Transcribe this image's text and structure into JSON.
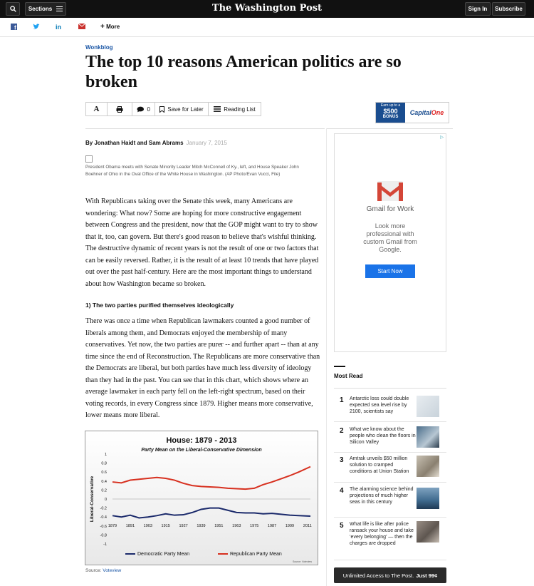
{
  "nav": {
    "sections_label": "Sections",
    "logo": "The Washington Post",
    "signin_label": "Sign In",
    "subscribe_label": "Subscribe"
  },
  "share": {
    "more_label": "More"
  },
  "article": {
    "kicker": "Wonkblog",
    "headline": "The top 10 reasons American politics are so broken",
    "comment_count": "0",
    "save_label": "Save for Later",
    "reading_list_label": "Reading List",
    "byline": "By Jonathan Haidt and Sam Abrams",
    "date": "January 7, 2015",
    "caption": "President Obama meets with Senate Minority Leader Mitch McConnell of Ky., left, and House Speaker John Boehner of Ohio in the Oval Office of the White House in Washington. (AP Photo/Evan Vucci, File)",
    "para1": "With Republicans taking over the Senate this week, many Americans are wondering: What now? Some are hoping for more constructive engagement between Congress and the president, now that the GOP might want to try to show that it, too, can govern. But there's good reason to believe that's wishful thinking. The destructive dynamic of recent years is not the result of one or two factors that can be easily reversed. Rather, it is the result of at least 10 trends that have played out over the past half-century. Here are the most important things to understand about how Washington became so broken.",
    "subhead1": "1) The two parties purified themselves ideologically",
    "para2": "There was once a time when Republican lawmakers counted a good number of liberals among them, and Democrats enjoyed the membership of many conservatives. Yet now, the two parties are purer -- and further apart --  than at any time since the end of Reconstruction. The Republicans are more conservative than the Democrats are liberal, but both parties have much less diversity of ideology than they had in the past. You can see that in this chart, which shows where an average lawmaker in each party fell on the left-right spectrum, based on their voting records, in every Congress since 1879. Higher means more conservative, lower means more liberal.",
    "source_prefix": "Source: ",
    "source_link": "Voteview"
  },
  "banner_ad": {
    "line1": "Earn up to a",
    "amount": "$500",
    "bonus": "BONUS",
    "brand_a": "Capital",
    "brand_b": "One"
  },
  "side_ad": {
    "title": "Gmail for Work",
    "body": "Look more professional with custom Gmail from Google.",
    "button": "Start Now"
  },
  "most_read": {
    "title": "Most Read",
    "items": [
      {
        "num": "1",
        "text": "Antarctic loss could double expected sea level rise by 2100, scientists say"
      },
      {
        "num": "2",
        "text": "What we know about the people who clean the floors in Silicon Valley"
      },
      {
        "num": "3",
        "text": "Amtrak unveils $50 million solution to cramped conditions at Union Station"
      },
      {
        "num": "4",
        "text": "The alarming science behind projections of much higher seas in this century"
      },
      {
        "num": "5",
        "text": "What life is like after police ransack your house and take ‘every belonging’ — then the charges are dropped"
      }
    ]
  },
  "cta": {
    "text": "Unlimited Access to The Post.",
    "price": "Just 99¢"
  },
  "colors": {
    "democratic": "#1b2a6b",
    "republican": "#d7301f",
    "link": "#1955a5"
  },
  "chart_data": {
    "type": "line",
    "title": "House: 1879 - 2013",
    "subtitle": "Party Mean on the Liberal-Conservative  Dimension",
    "ylabel": "Liberal-Conservative",
    "xlabel": "",
    "ylim": [
      -1,
      1
    ],
    "yticks": [
      "1",
      "0.8",
      "0.6",
      "0.4",
      "0.2",
      "0",
      "-0.2",
      "-0.4",
      "-0.6",
      "-0.8",
      "-1"
    ],
    "xticks": [
      "1879",
      "1891",
      "1903",
      "1915",
      "1927",
      "1939",
      "1951",
      "1963",
      "1975",
      "1987",
      "1999",
      "2011"
    ],
    "x": [
      1879,
      1885,
      1891,
      1897,
      1903,
      1909,
      1915,
      1921,
      1927,
      1933,
      1939,
      1945,
      1951,
      1957,
      1963,
      1969,
      1975,
      1981,
      1987,
      1993,
      1999,
      2005,
      2013
    ],
    "series": [
      {
        "name": "Democratic Party Mean",
        "color": "#1b2a6b",
        "values": [
          -0.37,
          -0.4,
          -0.36,
          -0.42,
          -0.4,
          -0.37,
          -0.33,
          -0.36,
          -0.35,
          -0.3,
          -0.23,
          -0.2,
          -0.2,
          -0.25,
          -0.3,
          -0.31,
          -0.31,
          -0.33,
          -0.32,
          -0.34,
          -0.36,
          -0.37,
          -0.38
        ]
      },
      {
        "name": "Republican Party Mean",
        "color": "#d7301f",
        "values": [
          0.38,
          0.36,
          0.42,
          0.44,
          0.46,
          0.48,
          0.46,
          0.42,
          0.35,
          0.3,
          0.28,
          0.27,
          0.26,
          0.24,
          0.23,
          0.22,
          0.24,
          0.32,
          0.38,
          0.45,
          0.52,
          0.6,
          0.72
        ]
      }
    ],
    "legend": "bottom",
    "footnote": "Source: Voteview"
  }
}
